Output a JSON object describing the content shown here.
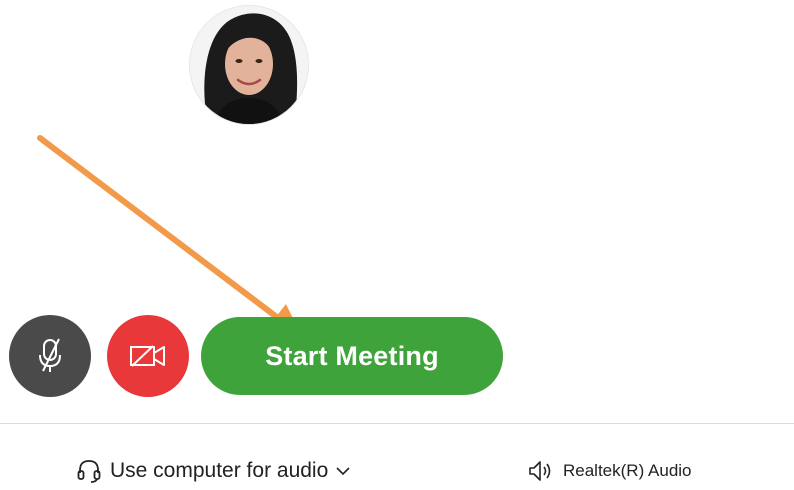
{
  "participant": {
    "avatar_alt": "participant-photo"
  },
  "controls": {
    "mute_icon": "mic-muted-icon",
    "video_icon": "video-off-icon",
    "start_label": "Start Meeting"
  },
  "audio": {
    "connect_icon": "headset-icon",
    "connect_label": "Use computer for audio",
    "connect_chevron": "chevron-down-icon",
    "speaker_icon": "speaker-icon",
    "speaker_label": "Realtek(R) Audio"
  },
  "colors": {
    "start_green": "#3ea33a",
    "video_red": "#e8383a",
    "mute_gray": "#4a4a4a",
    "annotation_orange": "#f29a4a"
  }
}
